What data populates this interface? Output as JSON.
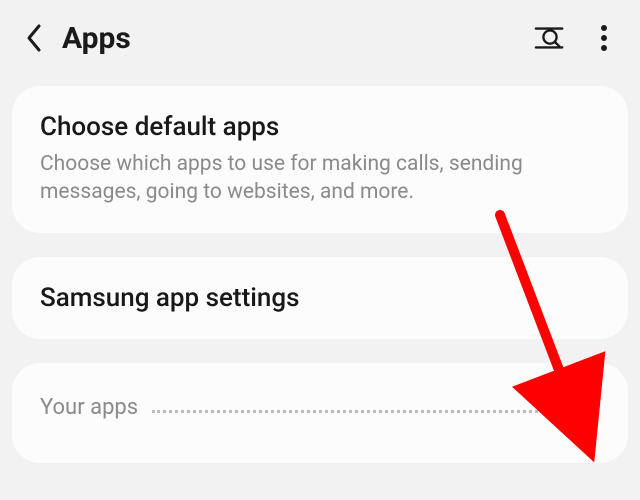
{
  "header": {
    "title": "Apps"
  },
  "cards": {
    "default": {
      "title": "Choose default apps",
      "desc": "Choose which apps to use for making calls, sending messages, going to websites, and more."
    },
    "samsung": {
      "title": "Samsung app settings"
    }
  },
  "list": {
    "section_label": "Your apps"
  },
  "annotation": {
    "color": "#ff0000"
  }
}
